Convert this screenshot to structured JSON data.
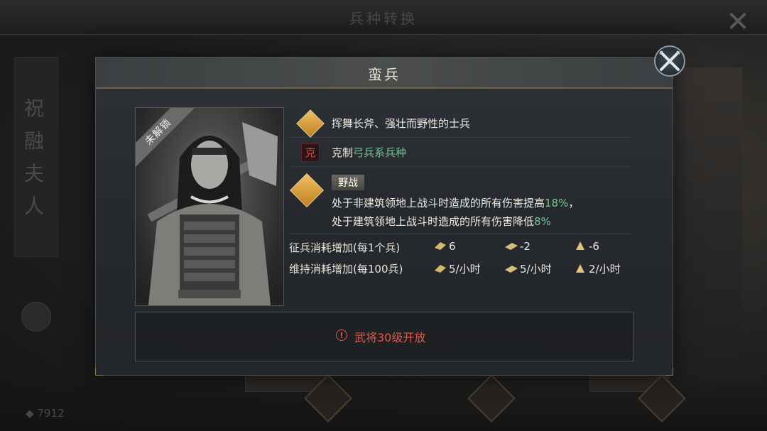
{
  "background": {
    "title": "兵种转换",
    "side_name": [
      "祝",
      "融",
      "夫",
      "人"
    ],
    "coins": "7912"
  },
  "panel": {
    "title": "蛮兵",
    "portrait": {
      "lock_label": "未解锁",
      "icon": "barbarian-axe-warrior-portrait"
    },
    "description": "挥舞长斧、强壮而野性的士兵",
    "counter": {
      "badge": "克",
      "prefix": "克制",
      "target": "弓兵系兵种"
    },
    "skill": {
      "name": "野战",
      "line1_prefix": "处于非建筑领地上战斗时造成的所有伤害提高",
      "line1_value": "18%",
      "line1_suffix": "，",
      "line2_prefix": "处于建筑领地上战斗时造成的所有伤害降低",
      "line2_value": "8%"
    },
    "costs": {
      "recruit_label": "征兵消耗增加(每1个兵)",
      "recruit": [
        "6",
        "-2",
        "-6"
      ],
      "upkeep_label": "维持消耗增加(每100兵)",
      "upkeep": [
        "5/小时",
        "5/小时",
        "2/小时"
      ]
    },
    "unlock": {
      "icon": "!",
      "text": "武将30级开放"
    }
  },
  "colors": {
    "accent_gold": "#e0a63c",
    "green_value": "#7cc49a",
    "warning_red": "#e2574b"
  }
}
